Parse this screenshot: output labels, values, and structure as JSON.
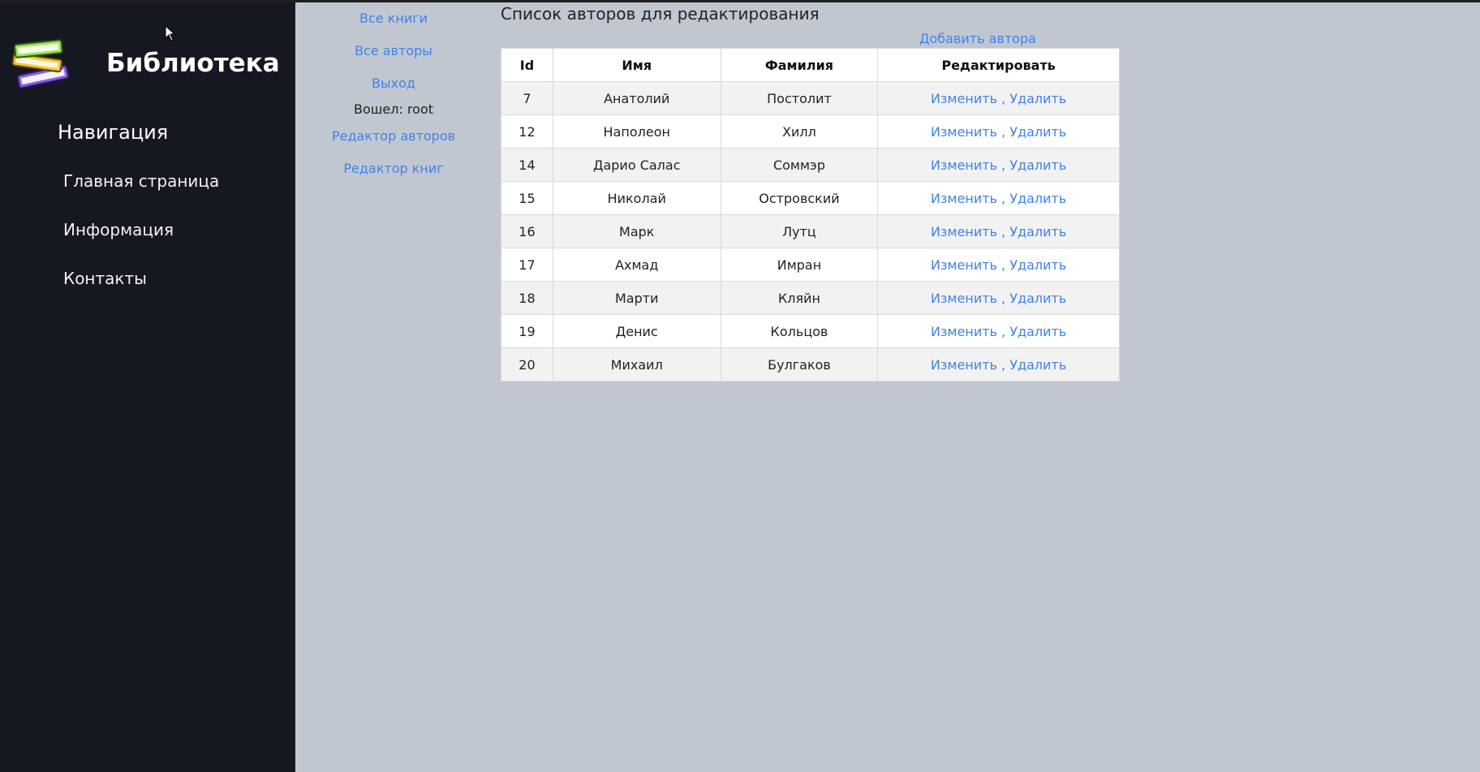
{
  "app": {
    "brand": "Библиотека"
  },
  "sidebar": {
    "heading": "Навигация",
    "items": [
      {
        "label": "Главная страница"
      },
      {
        "label": "Информация"
      },
      {
        "label": "Контакты"
      }
    ]
  },
  "links": {
    "all_books": "Все книги",
    "all_authors": "Все авторы",
    "logout": "Выход",
    "logged_in": "Вошел: root",
    "authors_editor": "Редактор авторов",
    "books_editor": "Редактор книг"
  },
  "main": {
    "title": "Список авторов для редактирования",
    "add_author": "Добавить автора",
    "columns": [
      "Id",
      "Имя",
      "Фамилия",
      "Редактировать"
    ],
    "edit_label": "Изменить",
    "separator": ",",
    "delete_label": "Удалить",
    "rows": [
      {
        "id": "7",
        "first": "Анатолий",
        "last": "Постолит"
      },
      {
        "id": "12",
        "first": "Наполеон",
        "last": "Хилл"
      },
      {
        "id": "14",
        "first": "Дарио Салас",
        "last": "Соммэр"
      },
      {
        "id": "15",
        "first": "Николай",
        "last": "Островский"
      },
      {
        "id": "16",
        "first": "Марк",
        "last": "Лутц"
      },
      {
        "id": "17",
        "first": "Ахмад",
        "last": "Имран"
      },
      {
        "id": "18",
        "first": "Марти",
        "last": "Кляйн"
      },
      {
        "id": "19",
        "first": "Денис",
        "last": "Кольцов"
      },
      {
        "id": "20",
        "first": "Михаил",
        "last": "Булгаков"
      }
    ]
  },
  "colors": {
    "sidebar_bg": "#151820",
    "page_bg": "#c1c7d1",
    "link": "#3f82e8"
  },
  "icons": {
    "logo": "books-stack-icon",
    "cursor": "mouse-cursor-icon"
  }
}
